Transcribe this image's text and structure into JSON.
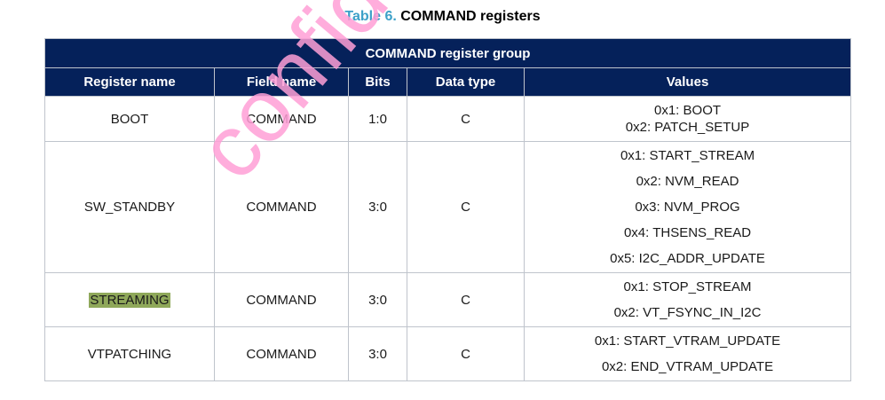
{
  "caption": {
    "number": "Table 6.",
    "title": "COMMAND registers"
  },
  "group_title": "COMMAND register group",
  "headers": [
    "Register name",
    "Field name",
    "Bits",
    "Data type",
    "Values"
  ],
  "rows": [
    {
      "register": "BOOT",
      "field": "COMMAND",
      "bits": "1:0",
      "type": "C",
      "values": [
        "0x1: BOOT",
        "0x2: PATCH_SETUP"
      ]
    },
    {
      "register": "SW_STANDBY",
      "field": "COMMAND",
      "bits": "3:0",
      "type": "C",
      "values": [
        "0x1: START_STREAM",
        "0x2: NVM_READ",
        "0x3: NVM_PROG",
        "0x4: THSENS_READ",
        "0x5: I2C_ADDR_UPDATE"
      ]
    },
    {
      "register": "STREAMING",
      "field": "COMMAND",
      "bits": "3:0",
      "type": "C",
      "values": [
        "0x1: STOP_STREAM",
        "0x2: VT_FSYNC_IN_I2C"
      ]
    },
    {
      "register": "VTPATCHING",
      "field": "COMMAND",
      "bits": "3:0",
      "type": "C",
      "values": [
        "0x1: START_VTRAM_UPDATE",
        "0x2: END_VTRAM_UPDATE"
      ]
    }
  ],
  "watermark": "confidential",
  "colors": {
    "header_bg": "#05215a",
    "caption_accent": "#3ca0c8",
    "highlight": "#8fa85a",
    "watermark": "#ff9fd6"
  }
}
